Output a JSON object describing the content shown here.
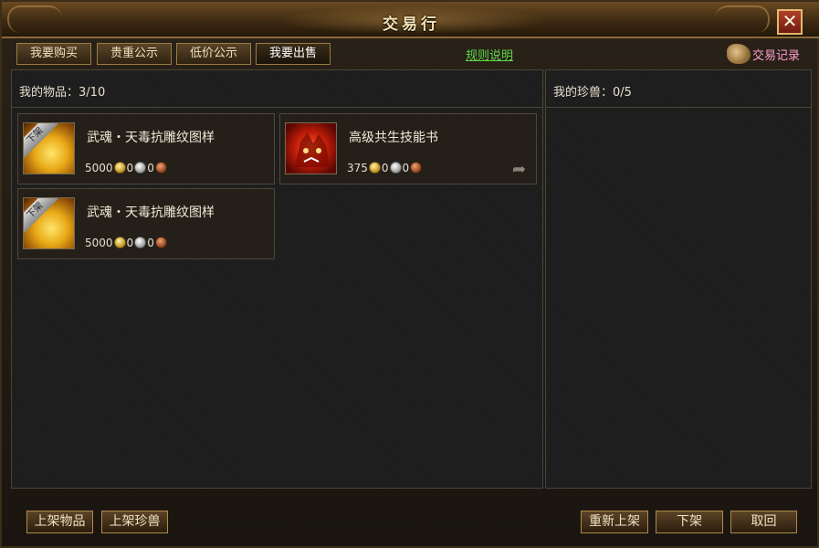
{
  "window": {
    "title": "交易行"
  },
  "tabs": [
    {
      "label": "我要购买"
    },
    {
      "label": "贵重公示"
    },
    {
      "label": "低价公示"
    },
    {
      "label": "我要出售"
    }
  ],
  "rules_link": "规则说明",
  "history_label": "交易记录",
  "close_glyph": "✕",
  "items_panel": {
    "label": "我的物品：",
    "count": "3/10"
  },
  "pets_panel": {
    "label": "我的珍兽：",
    "count": "0/5"
  },
  "items": [
    {
      "name": "武魂・天毒抗雕纹图样",
      "gold": "5000",
      "silver": "0",
      "copper": "0",
      "badge": "下架",
      "icon": "gold-pattern-icon"
    },
    {
      "name": "高级共生技能书",
      "gold": "375",
      "silver": "0",
      "copper": "0",
      "badge": "",
      "icon": "red-beast-icon"
    },
    {
      "name": "武魂・天毒抗雕纹图样",
      "gold": "5000",
      "silver": "0",
      "copper": "0",
      "badge": "下架",
      "icon": "gold-pattern-icon"
    }
  ],
  "buttons": {
    "list_item": "上架物品",
    "list_pet": "上架珍兽",
    "relist": "重新上架",
    "delist": "下架",
    "cancel": "取回"
  },
  "colors": {
    "link": "#5fd84a",
    "history": "#ff9fd0",
    "title": "#f4e2b4"
  }
}
